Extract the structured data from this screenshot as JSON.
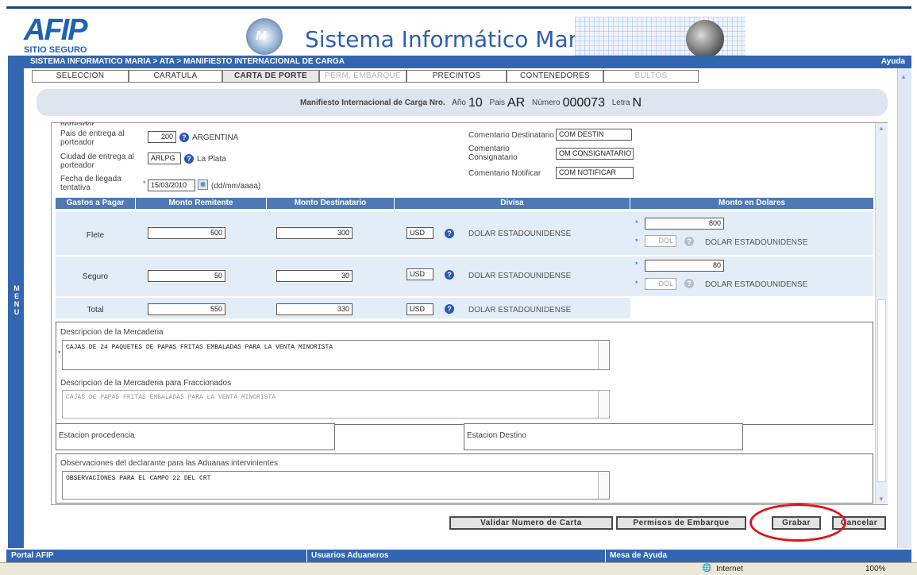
{
  "header": {
    "afip_logo_text": "AFIP",
    "afip_sub": "SITIO SEGURO",
    "system_title": "Sistema Informático Maria"
  },
  "breadcrumb": "SISTEMA INFORMATICO MARIA > ATA > MANIFIESTO INTERNACIONAL DE CARGA",
  "help_label": "Ayuda",
  "side_menu_label": "MENU",
  "tabs": [
    {
      "label": "SELECCION",
      "state": "normal"
    },
    {
      "label": "CARATULA",
      "state": "normal"
    },
    {
      "label": "CARTA DE PORTE",
      "state": "active"
    },
    {
      "label": "PERM. EMBARQUE",
      "state": "disabled"
    },
    {
      "label": "PRECINTOS",
      "state": "normal"
    },
    {
      "label": "CONTENEDORES",
      "state": "normal"
    },
    {
      "label": "BULTOS",
      "state": "disabled"
    }
  ],
  "manifest": {
    "label": "Manifiesto Internacional de Carga Nro.",
    "anio_label": "Año",
    "anio": "10",
    "pais_label": "Pais",
    "pais": "AR",
    "numero_label": "Número",
    "numero": "000073",
    "letra_label": "Letra",
    "letra": "N"
  },
  "form": {
    "cut_label": "porteador",
    "pais_entrega_label": "Pais de entrega al porteador",
    "pais_entrega_code": "200",
    "pais_entrega_name": "ARGENTINA",
    "ciudad_entrega_label": "Ciudad de entrega al porteador",
    "ciudad_entrega_code": "ARLPG",
    "ciudad_entrega_name": "La Plata",
    "fecha_label": "Fecha de llegada tentativa",
    "fecha_value": "15/03/2010",
    "fecha_hint": "(dd/mm/aaaa)",
    "coment_dest_label": "Comentario Destinatario",
    "coment_dest_value": "COM DESTIN",
    "coment_consig_label": "Comentario Consignatario",
    "coment_consig_value": "OM CONSIGNATARIO",
    "coment_notif_label": "Comentario Notificar",
    "coment_notif_value": "COM NOTIFICAR"
  },
  "gastos": {
    "headers": [
      "Gastos a Pagar",
      "Monto Remitente",
      "Monto Destinatario",
      "Divisa",
      "Monto en Dolares"
    ],
    "rows": [
      {
        "label": "Flete",
        "remitente": "500",
        "destinatario": "300",
        "divisa": "USD",
        "divisa_name": "DOLAR ESTADOUNIDENSE",
        "dolares": "800",
        "dol_code": "DOL",
        "dol_name": "DOLAR ESTADOUNIDENSE"
      },
      {
        "label": "Seguro",
        "remitente": "50",
        "destinatario": "30",
        "divisa": "USD",
        "divisa_name": "DOLAR ESTADOUNIDENSE",
        "dolares": "80",
        "dol_code": "DOL",
        "dol_name": "DOLAR ESTADOUNIDENSE"
      },
      {
        "label": "Total",
        "remitente": "550",
        "destinatario": "330",
        "divisa": "USD",
        "divisa_name": "DOLAR ESTADOUNIDENSE"
      }
    ]
  },
  "mercaderia": {
    "desc_label": "Descripcion de la Mercaderia",
    "desc_value": "CAJAS DE 24 PAQUETES DE PAPAS FRITAS EMBALADAS PARA LA VENTA MINORISTA",
    "frac_label": "Descripcion de la Mercaderia para Fraccionados",
    "frac_value": "CAJAS DE PAPAS FRITAS EMBALADAS PARA LA VENTA MINORISTA"
  },
  "estacion": {
    "procedencia_label": "Estacion procedencia",
    "destino_label": "Estacion Destino"
  },
  "observaciones": {
    "label": "Observaciones del declarante para las Aduanas intervinientes",
    "value": "OBSERVACIONES PARA EL CAMPO 22 DEL CRT"
  },
  "buttons": {
    "validar": "Validar Numero de Carta",
    "permisos": "Permisos de Embarque",
    "grabar": "Grabar",
    "cancelar": "Cancelar"
  },
  "footer": {
    "portal": "Portal AFIP",
    "usuarios": "Usuarios Aduaneros",
    "mesa": "Mesa de Ayuda"
  },
  "statusbar": {
    "zone": "Internet",
    "zoom": "100%"
  },
  "colors": {
    "brand_blue": "#3266b0",
    "table_header": "#4e79b4",
    "row_bg": "#e3edf8",
    "highlight_circle": "#e0141c"
  }
}
